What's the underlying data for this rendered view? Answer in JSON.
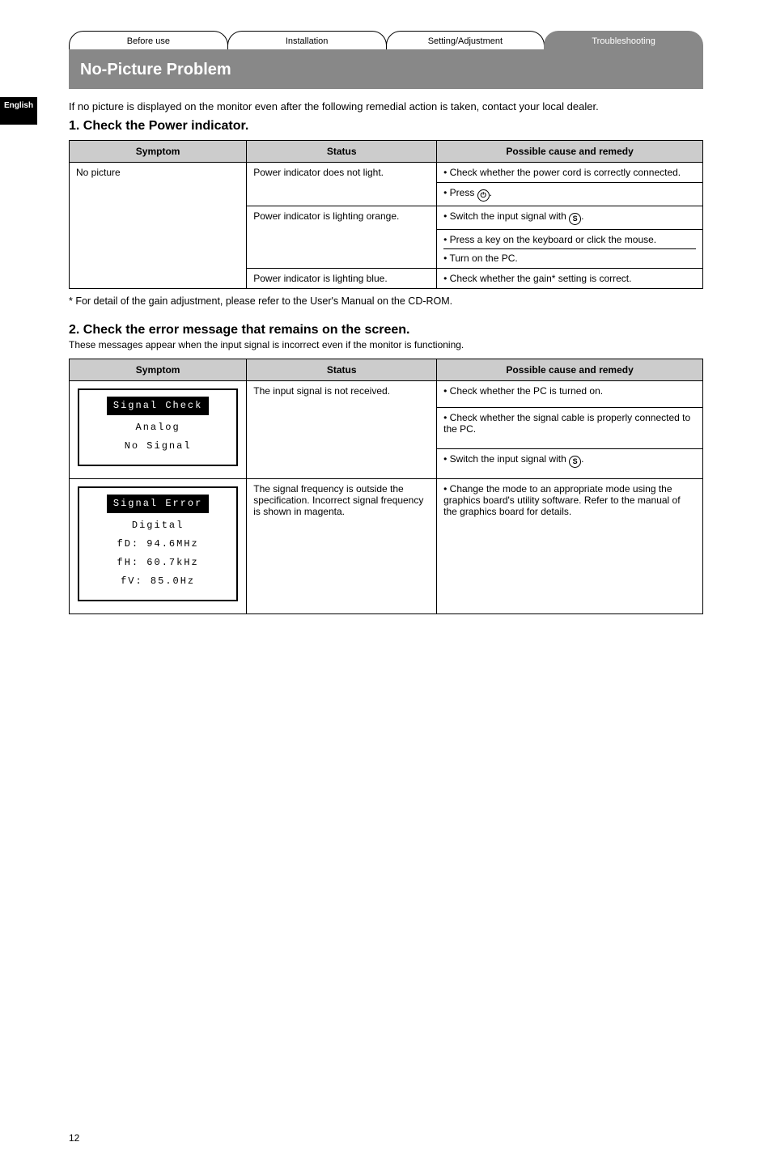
{
  "sideTab": {
    "line1": "English"
  },
  "tabs": [
    {
      "label": "Before use"
    },
    {
      "label": "Installation"
    },
    {
      "label": "Setting/Adjustment"
    },
    {
      "label": "Troubleshooting"
    }
  ],
  "banner": "No-Picture Problem",
  "intro": "If no picture is displayed on the monitor even after the following remedial action is taken, contact your local dealer.",
  "section1": {
    "heading": "1. Check the Power indicator.",
    "headers": {
      "symptom": "Symptom",
      "status": "Status",
      "action": "Possible cause and remedy"
    },
    "rows": [
      {
        "symptom": "No picture",
        "status1": "Power indicator does not light.",
        "actions1": [
          "Check whether the power cord is correctly connected.",
          {
            "pre": "Press ",
            "icon": "power",
            "post": "."
          }
        ],
        "status2": "Power indicator is lighting orange.",
        "actions2": [
          {
            "pre": "Switch the input signal with ",
            "icon": "S",
            "post": "."
          },
          "Press a key on the keyboard or click the mouse.",
          "Turn on the PC."
        ],
        "status3": "Power indicator is lighting blue.",
        "actions3": "Check whether the gain* setting is correct."
      }
    ],
    "footnote": "*  For detail of the gain adjustment, please refer to the User's Manual on the CD-ROM."
  },
  "section2": {
    "heading": "2. Check the error message that remains on the screen.",
    "sub": "These messages appear when the input signal is incorrect even if the monitor is functioning.",
    "headers": {
      "symptom": "Symptom",
      "status": "Status",
      "action": "Possible cause and remedy"
    },
    "box1": {
      "title": "Signal Check",
      "line1": "Analog",
      "line2": "No Signal"
    },
    "row1": {
      "status": "The input signal is not received.",
      "actions": [
        "Check whether the PC is turned on.",
        "Check whether the signal cable is properly connected to the PC.",
        {
          "pre": "Switch the input signal with ",
          "icon": "S",
          "post": "."
        }
      ]
    },
    "box2": {
      "title": "Signal Error",
      "line1": "Digital",
      "line2": "fD: 94.6MHz",
      "line3": "fH: 60.7kHz",
      "line4": "fV: 85.0Hz"
    },
    "row2": {
      "status": "The signal frequency is outside the specification. Incorrect signal frequency is shown in magenta.",
      "action": "Change the mode to an appropriate mode using the graphics board's utility software. Refer to the manual of the graphics board for details."
    }
  },
  "footer": "12"
}
